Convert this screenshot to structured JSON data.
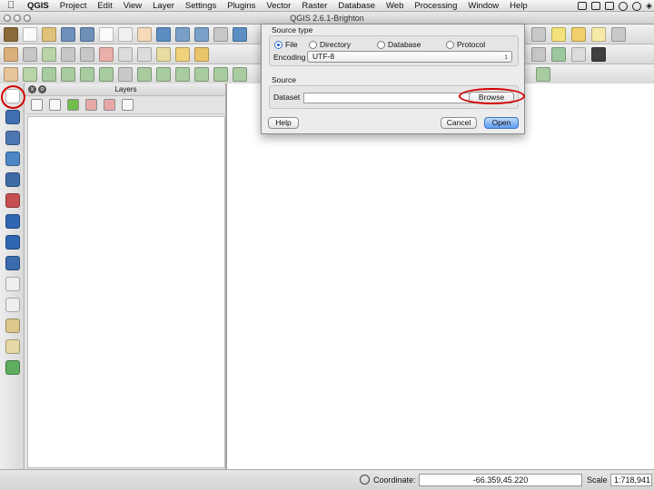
{
  "menubar": {
    "app": "QGIS",
    "items": [
      "Project",
      "Edit",
      "View",
      "Layer",
      "Settings",
      "Plugins",
      "Vector",
      "Raster",
      "Database",
      "Web",
      "Processing",
      "Window",
      "Help"
    ]
  },
  "window": {
    "title": "QGIS 2.6.1-Brighton"
  },
  "layers_panel": {
    "title": "Layers"
  },
  "dialog": {
    "source_type_label": "Source type",
    "options": [
      "File",
      "Directory",
      "Database",
      "Protocol"
    ],
    "selected_option": "File",
    "encoding_label": "Encoding",
    "encoding_value": "UTF-8",
    "source_label": "Source",
    "dataset_label": "Dataset",
    "browse_label": "Browse",
    "help_label": "Help",
    "cancel_label": "Cancel",
    "open_label": "Open"
  },
  "statusbar": {
    "coordinate_label": "Coordinate:",
    "coordinate_value": "-66.359,45.220",
    "scale_label": "Scale",
    "scale_value": "1:718,941"
  },
  "colors": {
    "highlight": "#d40000",
    "accent": "#5e9df1"
  },
  "icons": {
    "left_toolbar": [
      "add-vector-layer-icon",
      "add-raster-layer-icon",
      "add-postgis-layer-icon",
      "add-spatialite-layer-icon",
      "add-mssql-layer-icon",
      "add-oracle-layer-icon",
      "add-wms-layer-icon",
      "add-wcs-layer-icon",
      "add-wfs-layer-icon",
      "add-delimited-text-layer-icon",
      "new-shapefile-layer-icon",
      "new-spatialite-layer-icon",
      "add-gpx-layer-icon",
      "add-virtual-layer-icon"
    ]
  }
}
